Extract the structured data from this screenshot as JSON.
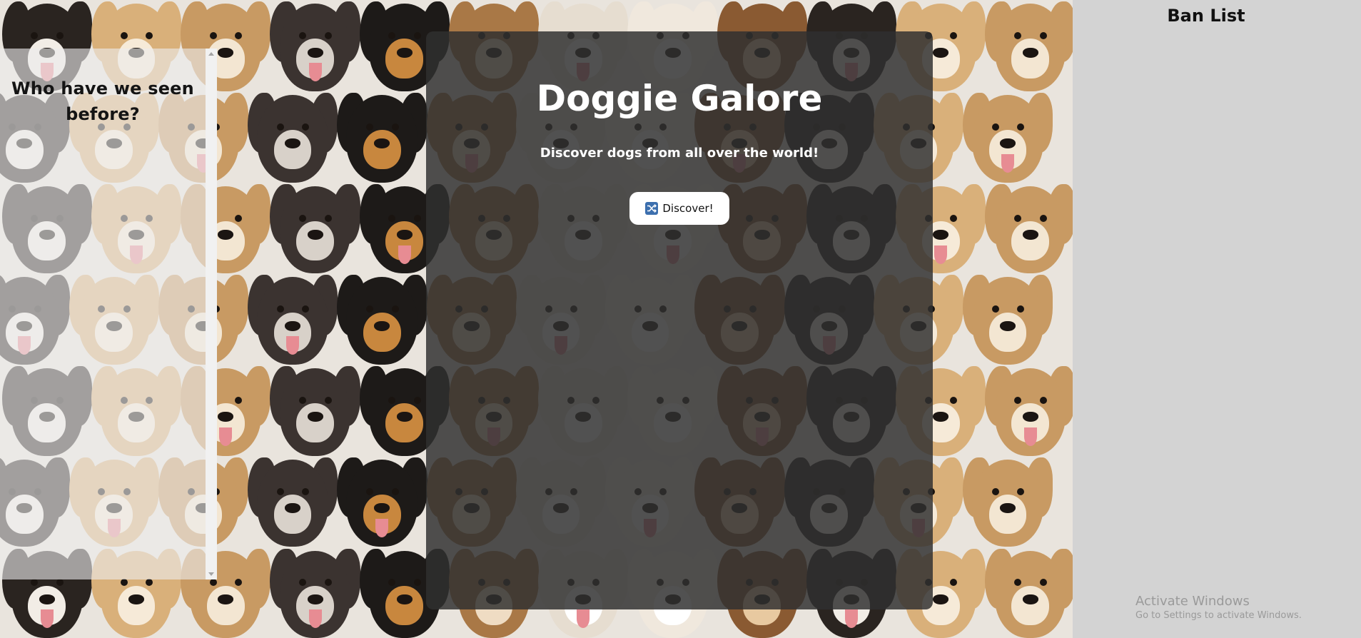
{
  "history": {
    "title": "Who have we seen before?"
  },
  "main": {
    "title": "Doggie Galore",
    "subtitle": "Discover dogs from all over the world!",
    "discover_label": "Discover!",
    "discover_icon": "shuffle-icon"
  },
  "ban_list": {
    "title": "Ban List"
  },
  "windows_notice": {
    "title": "Activate Windows",
    "subtitle": "Go to Settings to activate Windows."
  },
  "colors": {
    "card_background": "#303030",
    "button_background": "#ffffff",
    "ban_panel_background": "#d3d3d3",
    "shuffle_icon": "#3c6fae"
  }
}
